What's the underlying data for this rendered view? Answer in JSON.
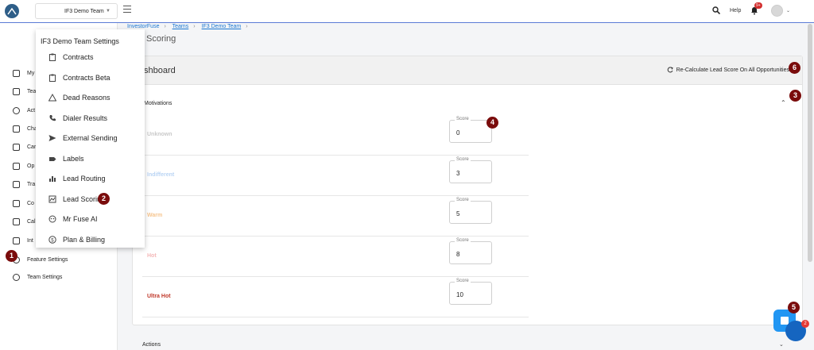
{
  "header": {
    "team_select": "IF3 Demo Team",
    "help": "Help",
    "notification_count": "9+"
  },
  "leftnav": {
    "items": [
      {
        "label": "My",
        "icon": "grid-icon"
      },
      {
        "label": "Tea",
        "icon": "layers-icon"
      },
      {
        "label": "Act",
        "icon": "check-circle-icon"
      },
      {
        "label": "Cha",
        "icon": "puzzle-icon"
      },
      {
        "label": "Car",
        "icon": "megaphone-icon"
      },
      {
        "label": "Op",
        "icon": "home-icon"
      },
      {
        "label": "Tra",
        "icon": "money-icon"
      },
      {
        "label": "Co",
        "icon": "people-icon"
      },
      {
        "label": "Cal",
        "icon": "calendar-icon"
      },
      {
        "label": "Int",
        "icon": "network-icon"
      },
      {
        "label": "Feature Settings",
        "icon": "gear-icon"
      },
      {
        "label": "Team Settings",
        "icon": "gear-icon"
      }
    ]
  },
  "dropdown": {
    "title": "IF3 Demo Team Settings",
    "items": [
      {
        "label": "Contracts",
        "icon": "clipboard-icon"
      },
      {
        "label": "Contracts Beta",
        "icon": "clipboard-icon"
      },
      {
        "label": "Dead Reasons",
        "icon": "warning-icon"
      },
      {
        "label": "Dialer Results",
        "icon": "phone-icon"
      },
      {
        "label": "External Sending",
        "icon": "send-icon"
      },
      {
        "label": "Labels",
        "icon": "label-icon"
      },
      {
        "label": "Lead Routing",
        "icon": "bar-chart-icon"
      },
      {
        "label": "Lead Scoring",
        "icon": "score-icon"
      },
      {
        "label": "Mr Fuse AI",
        "icon": "bot-icon"
      },
      {
        "label": "Plan & Billing",
        "icon": "dollar-icon"
      }
    ]
  },
  "breadcrumb": [
    "InvestorFuse",
    "Teams",
    "IF3 Demo Team"
  ],
  "page_title": "Scoring",
  "card": {
    "title": "shboard",
    "recalc": "Re-Calculate Lead Score On All Opportunities",
    "section": "Motivations",
    "score_legend": "Score",
    "rows": [
      {
        "label": "Unknown",
        "score": "0",
        "color": "#c9c9c9"
      },
      {
        "label": "Indifferent",
        "score": "3",
        "color": "#b9d4f4"
      },
      {
        "label": "Warm",
        "score": "5",
        "color": "#f6c58f"
      },
      {
        "label": "Hot",
        "score": "8",
        "color": "#f4b8b8"
      },
      {
        "label": "Ultra Hot",
        "score": "10",
        "color": "#c0392b"
      }
    ]
  },
  "actions_label": "Actions",
  "annotations": [
    "1",
    "2",
    "3",
    "4",
    "5",
    "6"
  ],
  "chat_badge": "2"
}
